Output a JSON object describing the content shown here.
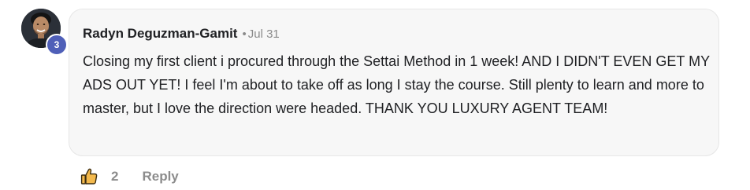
{
  "comment": {
    "author": "Radyn Deguzman-Gamit",
    "separator": "•",
    "date": "Jul 31",
    "level": "3",
    "body": "Closing my first client i procured through the Settai Method in 1 week! AND I DIDN'T EVEN GET MY ADS OUT YET! I feel I'm about to take off as long I stay the course. Still plenty to learn and more to master, but I love the direction were headed. THANK YOU LUXURY AGENT TEAM!",
    "like_count": "2",
    "reply_label": "Reply"
  },
  "icons": {
    "like": "thumbs-up-icon",
    "avatar": "user-avatar-photo"
  },
  "colors": {
    "bubble_bg": "#f7f7f7",
    "badge": "#4f5fb8",
    "like_icon": "#e8a33d",
    "muted_text": "#8c8c8c"
  }
}
